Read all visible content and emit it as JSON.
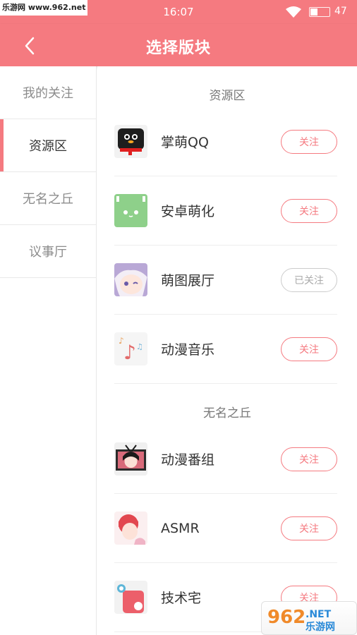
{
  "status_bar": {
    "time": "16:07",
    "battery_level": "47",
    "watermark": "乐游网 www.962.net"
  },
  "app_bar": {
    "title": "选择版块",
    "back_icon": "chevron-left-icon"
  },
  "sidebar": {
    "items": [
      {
        "label": "我的关注",
        "active": false
      },
      {
        "label": "资源区",
        "active": true
      },
      {
        "label": "无名之丘",
        "active": false
      },
      {
        "label": "议事厅",
        "active": false
      }
    ]
  },
  "sections": [
    {
      "title": "资源区",
      "items": [
        {
          "name": "掌萌QQ",
          "button": "关注",
          "followed": false,
          "icon": "penguin-icon"
        },
        {
          "name": "安卓萌化",
          "button": "关注",
          "followed": false,
          "icon": "android-icon"
        },
        {
          "name": "萌图展厅",
          "button": "已关注",
          "followed": true,
          "icon": "anime-girl-icon"
        },
        {
          "name": "动漫音乐",
          "button": "关注",
          "followed": false,
          "icon": "music-note-icon"
        }
      ]
    },
    {
      "title": "无名之丘",
      "items": [
        {
          "name": "动漫番组",
          "button": "关注",
          "followed": false,
          "icon": "anime-tv-icon"
        },
        {
          "name": "ASMR",
          "button": "关注",
          "followed": false,
          "icon": "asmr-girl-icon"
        },
        {
          "name": "技术宅",
          "button": "关注",
          "followed": false,
          "icon": "tech-shape-icon"
        }
      ]
    }
  ],
  "colors": {
    "accent": "#f57a80",
    "followed_border": "#cccccc"
  },
  "watermark_bottom": {
    "text": "962.NET 乐游网"
  }
}
